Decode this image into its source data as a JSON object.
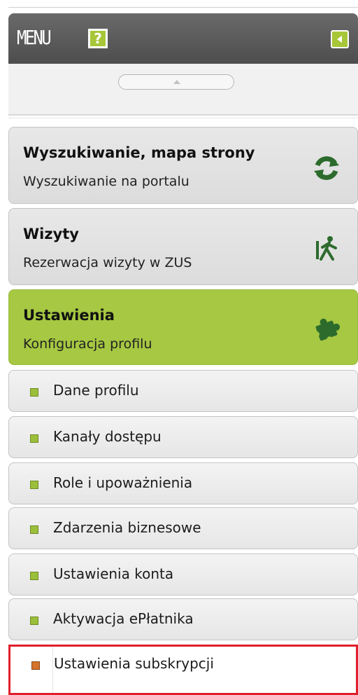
{
  "menu": {
    "title": "MENU",
    "help_label": "?"
  },
  "cards": [
    {
      "title": "Wyszukiwanie, mapa strony",
      "subtitle": "Wyszukiwanie na portalu",
      "icon": "refresh-icon"
    },
    {
      "title": "Wizyty",
      "subtitle": "Rezerwacja wizyty w ZUS",
      "icon": "walking-person-icon"
    },
    {
      "title": "Ustawienia",
      "subtitle": "Konfiguracja profilu",
      "icon": "puzzle-icon",
      "active": true
    }
  ],
  "submenu": [
    {
      "label": "Dane profilu"
    },
    {
      "label": "Kanały dostępu"
    },
    {
      "label": "Role i upoważnienia"
    },
    {
      "label": "Zdarzenia biznesowe"
    },
    {
      "label": "Ustawienia konta"
    },
    {
      "label": "Aktywacja ePłatnika"
    },
    {
      "label": "Ustawienia subskrypcji",
      "selected": true
    }
  ],
  "colors": {
    "header": "#5a5a5a",
    "accent_green": "#a6c842",
    "selection_border": "#e0202d",
    "bullet_orange": "#d3742a"
  }
}
